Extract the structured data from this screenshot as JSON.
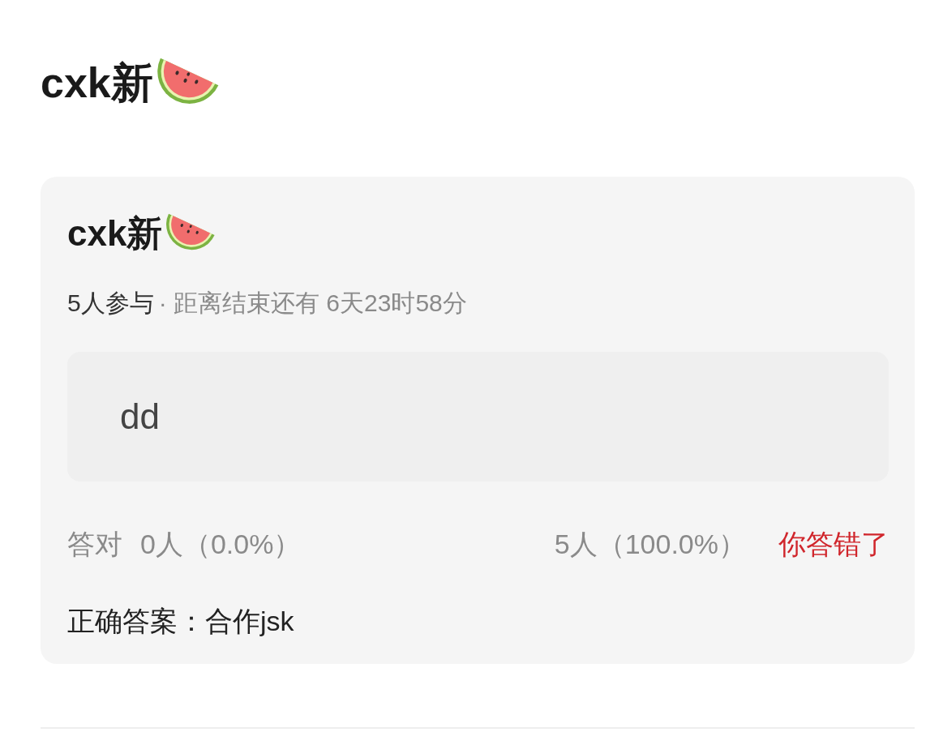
{
  "page_title": "cxk新",
  "poll_card": {
    "title": "cxk新",
    "participants": "5人参与",
    "countdown": "· 距离结束还有 6天23时58分",
    "options": [
      {
        "text": "dd"
      }
    ],
    "stats": {
      "correct_label": "答对",
      "correct_count": "0人（0.0%）",
      "wrong_count": "5人（100.0%）"
    },
    "result": {
      "text": "你答错了",
      "correct": false
    },
    "correct_answer": "正确答案：合作jsk"
  }
}
